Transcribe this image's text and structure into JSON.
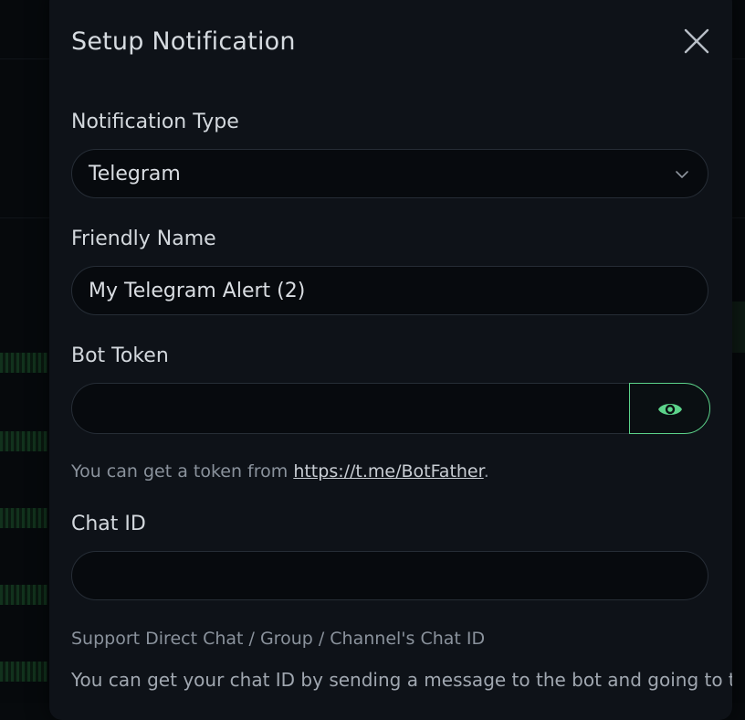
{
  "modal": {
    "title": "Setup Notification"
  },
  "notification_type": {
    "label": "Notification Type",
    "selected": "Telegram"
  },
  "friendly_name": {
    "label": "Friendly Name",
    "value": "My Telegram Alert (2)"
  },
  "bot_token": {
    "label": "Bot Token",
    "value": "",
    "help_prefix": "You can get a token from ",
    "help_link": "https://t.me/BotFather",
    "help_suffix": "."
  },
  "chat_id": {
    "label": "Chat ID",
    "value": "",
    "support_text": "Support Direct Chat / Group / Channel's Chat ID",
    "help_text": "You can get your chat ID by sending a message to the bot and going to this"
  },
  "icons": {
    "close": "close-icon",
    "dropdown": "chevron-down-icon",
    "toggle_visibility": "eye-icon"
  },
  "colors": {
    "accent": "#5cd38a",
    "modal_bg": "#0e1218",
    "input_bg": "#070a0e"
  }
}
